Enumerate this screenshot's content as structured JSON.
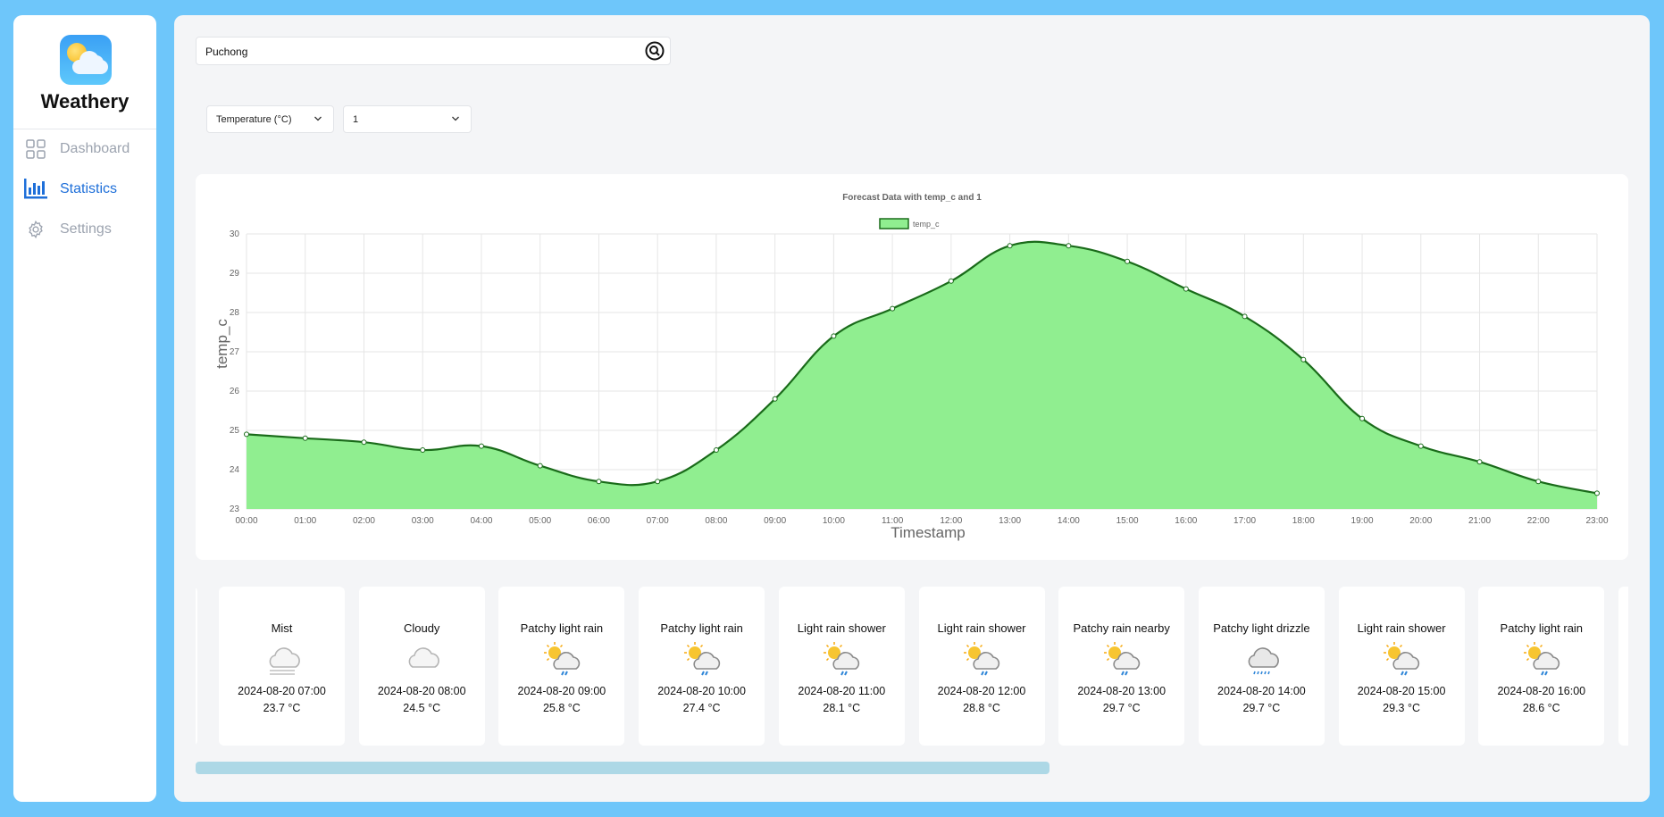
{
  "app": {
    "name": "Weathery"
  },
  "sidebar": {
    "items": [
      {
        "label": "Dashboard",
        "icon": "grid-icon",
        "active": false
      },
      {
        "label": "Statistics",
        "icon": "bar-chart-icon",
        "active": true
      },
      {
        "label": "Settings",
        "icon": "gear-icon",
        "active": false
      }
    ]
  },
  "search": {
    "value": "Puchong",
    "placeholder": ""
  },
  "filters": {
    "metric": "Temperature (°C)",
    "days": "1"
  },
  "colors": {
    "accent": "#1e6fd9",
    "fill": "#90ee90",
    "line": "#1a6b1a",
    "scroll": "#add8e6",
    "background": "#6ec6fa"
  },
  "chart_data": {
    "type": "area",
    "title": "Forecast Data with temp_c and 1",
    "xlabel": "Timestamp",
    "ylabel": "temp_c",
    "legend": [
      "temp_c"
    ],
    "legend_position": "top",
    "grid": true,
    "ylim": [
      23,
      30
    ],
    "yticks": [
      "30",
      "29",
      "28",
      "27",
      "26",
      "25",
      "24",
      "23"
    ],
    "x": [
      "00:00",
      "01:00",
      "02:00",
      "03:00",
      "04:00",
      "05:00",
      "06:00",
      "07:00",
      "08:00",
      "09:00",
      "10:00",
      "11:00",
      "12:00",
      "13:00",
      "14:00",
      "15:00",
      "16:00",
      "17:00",
      "18:00",
      "19:00",
      "20:00",
      "21:00",
      "22:00",
      "23:00"
    ],
    "series": [
      {
        "name": "temp_c",
        "values": [
          24.9,
          24.8,
          24.7,
          24.5,
          24.6,
          24.1,
          23.7,
          23.7,
          24.5,
          25.8,
          27.4,
          28.1,
          28.8,
          29.7,
          29.7,
          29.3,
          28.6,
          27.9,
          26.8,
          25.3,
          24.6,
          24.2,
          23.7,
          23.4
        ]
      }
    ]
  },
  "forecast_cards": [
    {
      "condition": "Mist",
      "icon": "mist-icon",
      "time": "2024-08-20 07:00",
      "temp": "23.7 °C"
    },
    {
      "condition": "Cloudy",
      "icon": "cloud-icon",
      "time": "2024-08-20 08:00",
      "temp": "24.5 °C"
    },
    {
      "condition": "Patchy light rain",
      "icon": "sun-cloud-rain-icon",
      "time": "2024-08-20 09:00",
      "temp": "25.8 °C"
    },
    {
      "condition": "Patchy light rain",
      "icon": "sun-cloud-rain-icon",
      "time": "2024-08-20 10:00",
      "temp": "27.4 °C"
    },
    {
      "condition": "Light rain shower",
      "icon": "sun-cloud-rain-icon",
      "time": "2024-08-20 11:00",
      "temp": "28.1 °C"
    },
    {
      "condition": "Light rain shower",
      "icon": "sun-cloud-rain-icon",
      "time": "2024-08-20 12:00",
      "temp": "28.8 °C"
    },
    {
      "condition": "Patchy rain nearby",
      "icon": "sun-cloud-rain-icon",
      "time": "2024-08-20 13:00",
      "temp": "29.7 °C"
    },
    {
      "condition": "Patchy light drizzle",
      "icon": "cloud-drizzle-icon",
      "time": "2024-08-20 14:00",
      "temp": "29.7 °C"
    },
    {
      "condition": "Light rain shower",
      "icon": "sun-cloud-rain-icon",
      "time": "2024-08-20 15:00",
      "temp": "29.3 °C"
    },
    {
      "condition": "Patchy light rain",
      "icon": "sun-cloud-rain-icon",
      "time": "2024-08-20 16:00",
      "temp": "28.6 °C"
    }
  ],
  "scroll": {
    "position": 0,
    "visible_fraction": 0.6
  }
}
